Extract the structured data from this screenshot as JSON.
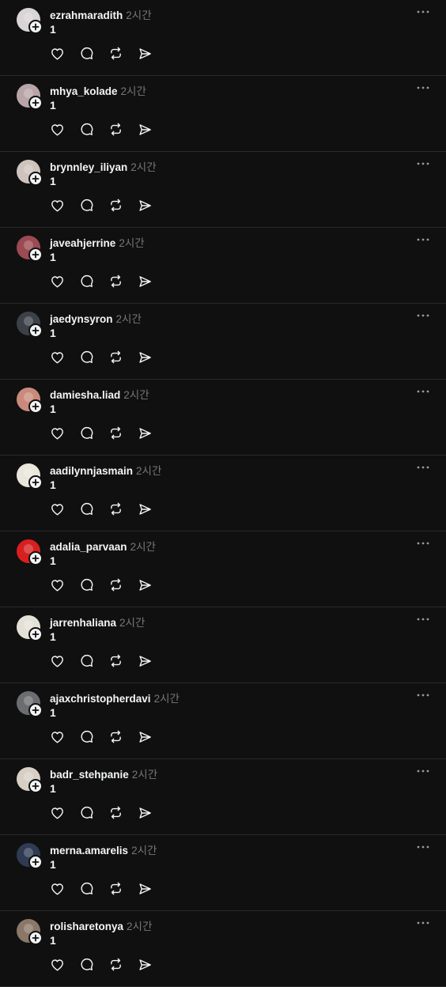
{
  "feed": {
    "posts": [
      {
        "username": "ezrahmaradith",
        "time": "2시간",
        "text": "1",
        "avatar_color": "#d9d4d6"
      },
      {
        "username": "mhya_kolade",
        "time": "2시간",
        "text": "1",
        "avatar_color": "#b9a5a8"
      },
      {
        "username": "brynnley_iliyan",
        "time": "2시간",
        "text": "1",
        "avatar_color": "#cfc3bd"
      },
      {
        "username": "javeahjerrine",
        "time": "2시간",
        "text": "1",
        "avatar_color": "#9b4a52"
      },
      {
        "username": "jaedynsyron",
        "time": "2시간",
        "text": "1",
        "avatar_color": "#3c4148"
      },
      {
        "username": "damiesha.liad",
        "time": "2시간",
        "text": "1",
        "avatar_color": "#c98a7c"
      },
      {
        "username": "aadilynnjasmain",
        "time": "2시간",
        "text": "1",
        "avatar_color": "#e9e6dc"
      },
      {
        "username": "adalia_parvaan",
        "time": "2시간",
        "text": "1",
        "avatar_color": "#d81f1f"
      },
      {
        "username": "jarrenhaliana",
        "time": "2시간",
        "text": "1",
        "avatar_color": "#e3e0d6"
      },
      {
        "username": "ajaxchristopherdavi",
        "time": "2시간",
        "text": "1",
        "avatar_color": "#6b6d70"
      },
      {
        "username": "badr_stehpanie",
        "time": "2시간",
        "text": "1",
        "avatar_color": "#d8cfc4"
      },
      {
        "username": "merna.amarelis",
        "time": "2시간",
        "text": "1",
        "avatar_color": "#2e3b52"
      },
      {
        "username": "rolisharetonya",
        "time": "2시간",
        "text": "1",
        "avatar_color": "#8a7767"
      }
    ],
    "actions": [
      "heart-icon",
      "comment-icon",
      "repost-icon",
      "share-icon"
    ],
    "more_icon": "more-icon",
    "follow_badge_icon": "plus-icon"
  }
}
